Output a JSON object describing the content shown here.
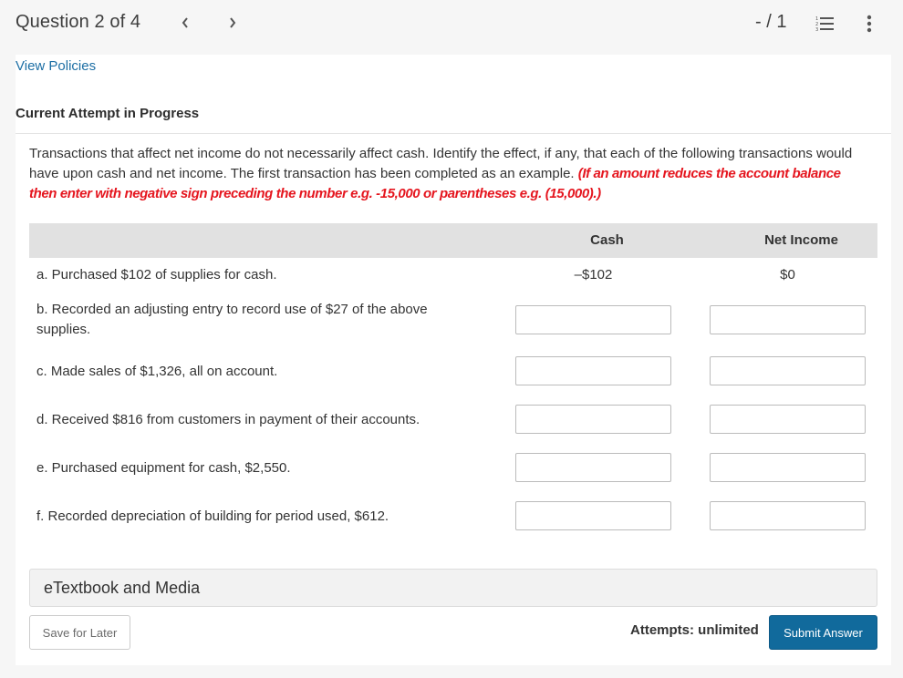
{
  "header": {
    "question_position": "Question 2 of 4",
    "prev_icon": "chevron-left-icon",
    "next_icon": "chevron-right-icon",
    "score": "- / 1",
    "list_icon": "numbered-list-icon",
    "more_icon": "vertical-ellipsis-icon"
  },
  "links": {
    "view_policies": "View Policies"
  },
  "attempt_heading": "Current Attempt in Progress",
  "question": {
    "text": "Transactions that affect net income do not necessarily affect cash. Identify the effect, if any, that each of the following transactions would have upon cash and net income. The first transaction has been completed as an example. ",
    "instruction": "(If an amount reduces the account balance then enter with negative sign preceding the number e.g. -15,000 or parentheses e.g. (15,000).)"
  },
  "table": {
    "columns": [
      "",
      "Cash",
      "Net Income"
    ],
    "rows": [
      {
        "label": "a. Purchased $102 of supplies for cash.",
        "cash": "–$102",
        "net_income": "$0"
      },
      {
        "label": "b. Recorded an adjusting entry to record use of $27 of the above supplies.",
        "cash": "",
        "net_income": ""
      },
      {
        "label": "c. Made sales of $1,326, all on account.",
        "cash": "",
        "net_income": ""
      },
      {
        "label": "d. Received $816 from customers in payment of their accounts.",
        "cash": "",
        "net_income": ""
      },
      {
        "label": "e. Purchased equipment for cash, $2,550.",
        "cash": "",
        "net_income": ""
      },
      {
        "label": "f. Recorded depreciation of building for period used, $612.",
        "cash": "",
        "net_income": ""
      }
    ]
  },
  "etextbook": "eTextbook and Media",
  "footer": {
    "save_label": "Save for Later",
    "attempts": "Attempts: unlimited",
    "submit_label": "Submit Answer"
  },
  "colors": {
    "link": "#1c6ea4",
    "emphasis": "#e5161f",
    "primary_button": "#116a9c",
    "table_header": "#e1e1e1"
  }
}
